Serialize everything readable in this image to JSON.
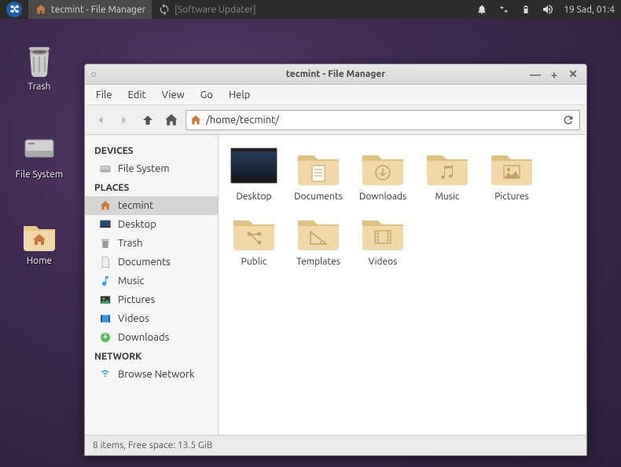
{
  "panel": {
    "app_task": "tecmint - File Manager",
    "bg_task": "[Software Updater]",
    "clock": "19 Sad, 01:4"
  },
  "desktop_icons": {
    "trash": "Trash",
    "filesystem": "File System",
    "home": "Home"
  },
  "window": {
    "title": "tecmint - File Manager",
    "menu": {
      "file": "File",
      "edit": "Edit",
      "view": "View",
      "go": "Go",
      "help": "Help"
    },
    "path": "/home/tecmint/",
    "sidebar": {
      "devices_header": "DEVICES",
      "filesystem": "File System",
      "places_header": "PLACES",
      "tecmint": "tecmint",
      "desktop": "Desktop",
      "trash": "Trash",
      "documents": "Documents",
      "music": "Music",
      "pictures": "Pictures",
      "videos": "Videos",
      "downloads": "Downloads",
      "network_header": "NETWORK",
      "browse_network": "Browse Network"
    },
    "files": {
      "desktop": "Desktop",
      "documents": "Documents",
      "downloads": "Downloads",
      "music": "Music",
      "pictures": "Pictures",
      "public": "Public",
      "templates": "Templates",
      "videos": "Videos"
    },
    "status": "8 items, Free space: 13.5 GiB"
  }
}
